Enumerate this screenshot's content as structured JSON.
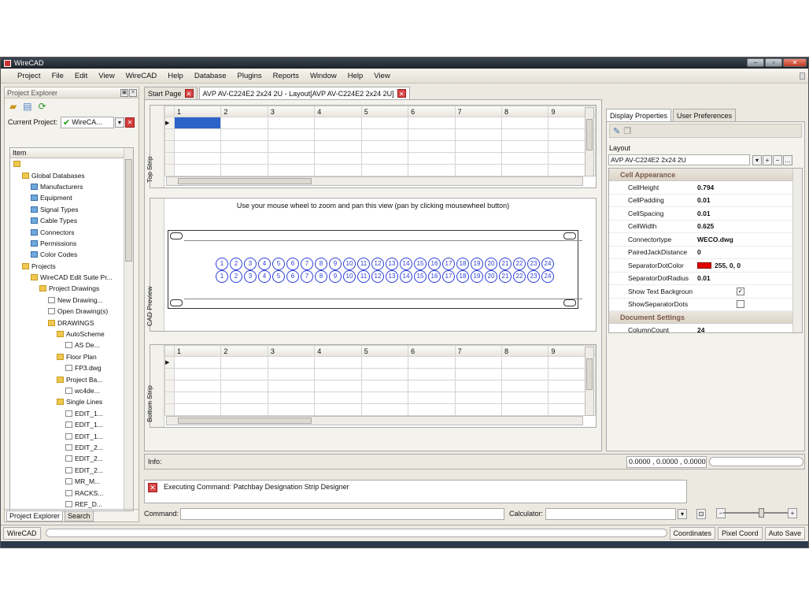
{
  "window": {
    "title": "WireCAD",
    "controls": [
      "–",
      "▫",
      "✕"
    ]
  },
  "menu": [
    "Project",
    "File",
    "Edit",
    "View",
    "WireCAD",
    "Help",
    "Database",
    "Plugins",
    "Reports",
    "Window",
    "Help",
    "View"
  ],
  "left_panel": {
    "title": "Project Explorer",
    "current_project_label": "Current Project:",
    "current_project_value": "WireCA...",
    "column_header": "Item",
    "tree": [
      {
        "label": "",
        "indent": 0,
        "kind": "folder"
      },
      {
        "label": "Global Databases",
        "indent": 1,
        "kind": "folder"
      },
      {
        "label": "Manufacturers",
        "indent": 2,
        "kind": "db"
      },
      {
        "label": "Equipment",
        "indent": 2,
        "kind": "db"
      },
      {
        "label": "Signal Types",
        "indent": 2,
        "kind": "db"
      },
      {
        "label": "Cable Types",
        "indent": 2,
        "kind": "db"
      },
      {
        "label": "Connectors",
        "indent": 2,
        "kind": "db"
      },
      {
        "label": "Permissions",
        "indent": 2,
        "kind": "db"
      },
      {
        "label": "Color Codes",
        "indent": 2,
        "kind": "db"
      },
      {
        "label": "Projects",
        "indent": 1,
        "kind": "folder"
      },
      {
        "label": "WireCAD Edit Suite Pr...",
        "indent": 2,
        "kind": "folder"
      },
      {
        "label": "Project Drawings",
        "indent": 3,
        "kind": "folder"
      },
      {
        "label": "New Drawing...",
        "indent": 4,
        "kind": "doc"
      },
      {
        "label": "Open Drawing(s)",
        "indent": 4,
        "kind": "doc"
      },
      {
        "label": "DRAWINGS",
        "indent": 4,
        "kind": "folder"
      },
      {
        "label": "AutoScheme",
        "indent": 5,
        "kind": "folder"
      },
      {
        "label": "AS De...",
        "indent": 6,
        "kind": "doc"
      },
      {
        "label": "Floor Plan",
        "indent": 5,
        "kind": "folder"
      },
      {
        "label": "FP3.dwg",
        "indent": 6,
        "kind": "doc"
      },
      {
        "label": "Project Ba...",
        "indent": 5,
        "kind": "folder"
      },
      {
        "label": "wc4de...",
        "indent": 6,
        "kind": "doc"
      },
      {
        "label": "Single Lines",
        "indent": 5,
        "kind": "folder"
      },
      {
        "label": "EDIT_1...",
        "indent": 6,
        "kind": "doc"
      },
      {
        "label": "EDIT_1...",
        "indent": 6,
        "kind": "doc"
      },
      {
        "label": "EDIT_1...",
        "indent": 6,
        "kind": "doc"
      },
      {
        "label": "EDIT_2...",
        "indent": 6,
        "kind": "doc"
      },
      {
        "label": "EDIT_2...",
        "indent": 6,
        "kind": "doc"
      },
      {
        "label": "EDIT_2...",
        "indent": 6,
        "kind": "doc"
      },
      {
        "label": "MR_M...",
        "indent": 6,
        "kind": "doc"
      },
      {
        "label": "RACKS...",
        "indent": 6,
        "kind": "doc"
      },
      {
        "label": "REF_D...",
        "indent": 6,
        "kind": "doc"
      }
    ],
    "bottom_tabs": [
      "Project Explorer",
      "Search"
    ]
  },
  "doc_tabs": [
    "Start Page",
    "AVP AV-C224E2 2x24 2U - Layout[AVP AV-C224E2 2x24 2U]"
  ],
  "grid": {
    "columns": [
      "1",
      "2",
      "3",
      "4",
      "5",
      "6",
      "7",
      "8",
      "9"
    ]
  },
  "top_strip_label": "Top Strip",
  "bottom_strip_label": "Bottom Strip",
  "cad_preview_label": "CAD Preview",
  "cad_preview_hint": "Use your mouse wheel to zoom and pan this view (pan by clicking mousewheel button)",
  "jacks": [
    "1",
    "2",
    "3",
    "4",
    "5",
    "6",
    "7",
    "8",
    "9",
    "10",
    "11",
    "12",
    "13",
    "14",
    "15",
    "16",
    "17",
    "18",
    "19",
    "20",
    "21",
    "22",
    "23",
    "24"
  ],
  "right_panel": {
    "tabs": [
      "Display Properties",
      "User Preferences"
    ],
    "layout_label": "Layout",
    "layout_value": "AVP AV-C224E2 2x24 2U",
    "sections": [
      {
        "title": "Cell Appearance"
      },
      {
        "title": "Document Settings"
      }
    ],
    "cell_appearance": [
      {
        "name": "CellHeight",
        "value": "0.794"
      },
      {
        "name": "CellPadding",
        "value": "0.01"
      },
      {
        "name": "CellSpacing",
        "value": "0.01"
      },
      {
        "name": "CellWidth",
        "value": "0.625"
      },
      {
        "name": "Connectortype",
        "value": "WECO.dwg"
      },
      {
        "name": "PairedJackDistance",
        "value": "0"
      },
      {
        "name": "SeparatorDotColor",
        "value": "255, 0, 0"
      },
      {
        "name": "SeparatorDotRadius",
        "value": "0.01"
      },
      {
        "name": "Show Text Backgroun",
        "value": "✓"
      },
      {
        "name": "ShowSeparatorDots",
        "value": ""
      }
    ],
    "document_settings": [
      {
        "name": "ColumnCount",
        "value": "24"
      }
    ],
    "separator_color": "#e00000"
  },
  "info": {
    "label": "Info:",
    "coords": "0.0000 , 0.0000 , 0.0000"
  },
  "command": {
    "log": "Executing Command: Patchbay Designation Strip Designer",
    "label": "Command:",
    "calculator_label": "Calculator:"
  },
  "status": {
    "app": "WireCAD",
    "items": [
      "Coordinates",
      "Pixel Coord",
      "Auto Save"
    ]
  },
  "colors": {
    "accent": "#2d62c8",
    "jack": "#2b3ed8",
    "category_text": "#7a5a4a"
  }
}
